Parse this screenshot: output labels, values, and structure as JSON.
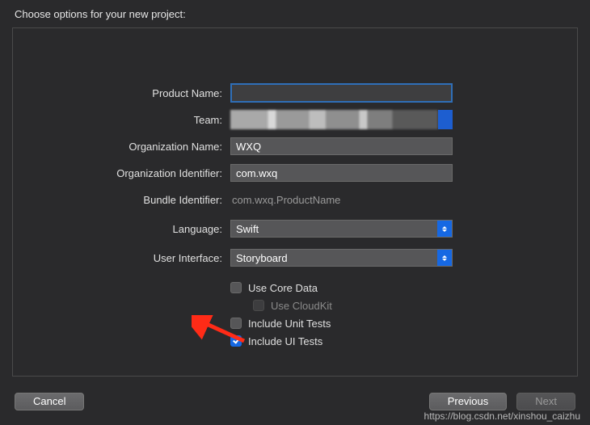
{
  "title": "Choose options for your new project:",
  "form": {
    "product_name_label": "Product Name:",
    "product_name_value": "",
    "team_label": "Team:",
    "org_name_label": "Organization Name:",
    "org_name_value": "WXQ",
    "org_id_label": "Organization Identifier:",
    "org_id_value": "com.wxq",
    "bundle_id_label": "Bundle Identifier:",
    "bundle_id_value": "com.wxq.ProductName",
    "language_label": "Language:",
    "language_value": "Swift",
    "ui_label": "User Interface:",
    "ui_value": "Storyboard"
  },
  "checks": {
    "core_data": "Use Core Data",
    "cloudkit": "Use CloudKit",
    "unit_tests": "Include Unit Tests",
    "ui_tests": "Include UI Tests"
  },
  "buttons": {
    "cancel": "Cancel",
    "previous": "Previous",
    "next": "Next"
  },
  "watermark": "https://blog.csdn.net/xinshou_caizhu"
}
